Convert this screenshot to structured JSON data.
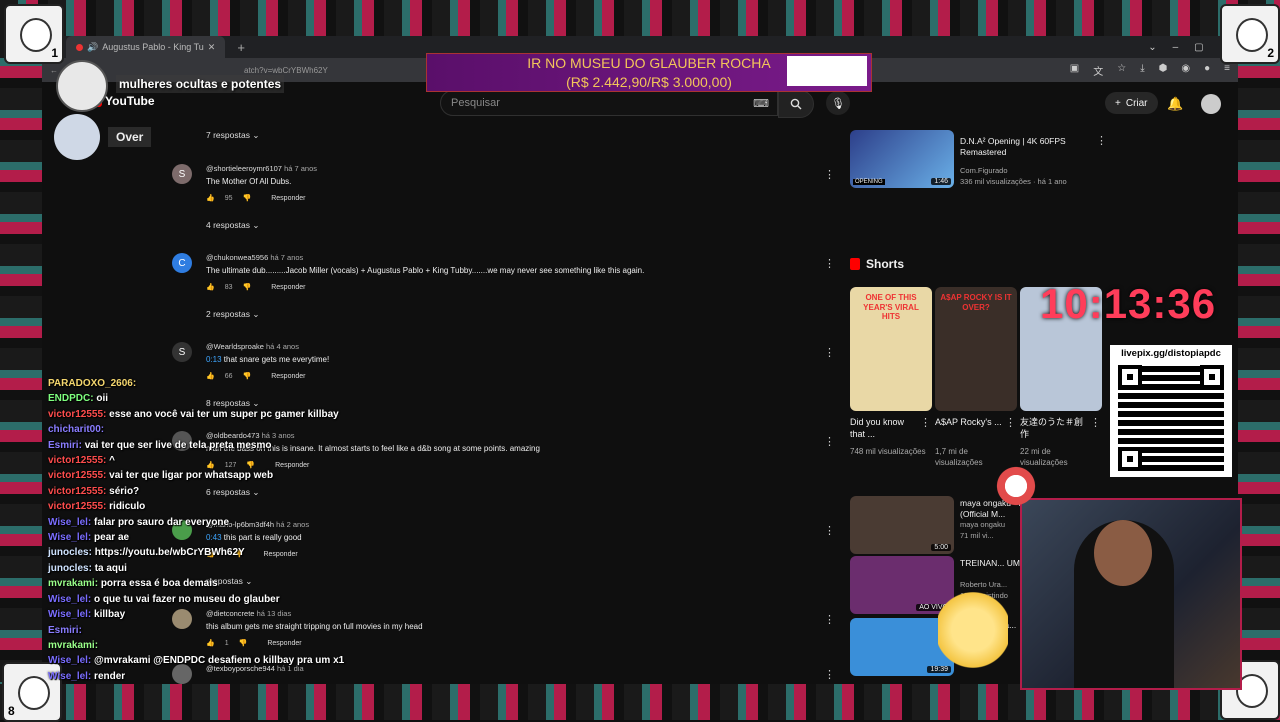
{
  "browser": {
    "tab_title": "Augustus Pablo - King Tu",
    "url": "atch?v=wbCrYBWh62Y"
  },
  "overlay": {
    "title_text": "mulheres ocultas e potentes",
    "over_label": "Over",
    "donation_line1": "IR NO MUSEU DO GLAUBER ROCHA",
    "donation_line2": "(R$ 2.442,90/R$ 3.000,00)",
    "clock": "10:13:36",
    "qr_label": "livepix.gg/distopiapdc",
    "corner_num_left": "1",
    "corner_num_right": "2",
    "corner_num_bl": "8"
  },
  "youtube": {
    "logo": "YouTube",
    "search_placeholder": "Pesquisar",
    "create_label": "Criar"
  },
  "comments": [
    {
      "replies": "7 respostas"
    },
    {
      "initial": "S",
      "user": "@shortieleeroymr6107",
      "age": "há 7 anos",
      "text": "The Mother Of All Dubs.",
      "likes": "95",
      "reply": "Responder",
      "replies": "4 respostas"
    },
    {
      "initial": "C",
      "user": "@chukonwea5956",
      "age": "há 7 anos",
      "text": "The ultimate dub.........Jacob Miller (vocals) + Augustus Pablo + King Tubby.......we may never see something like this again.",
      "likes": "83",
      "reply": "Responder",
      "replies": "2 respostas"
    },
    {
      "initial": "S",
      "user": "@Wearldsproake",
      "age": "há 4 anos",
      "ts": "0:13",
      "text": " that snare gets me everytime!",
      "likes": "66",
      "reply": "Responder",
      "replies": "8 respostas"
    },
    {
      "initial": "",
      "user": "@oldbeardo473",
      "age": "há 3 anos",
      "text": "man the bass on this is insane. It almost starts to feel like a d&b song at some points. amazing",
      "likes": "127",
      "reply": "Responder",
      "replies": "6 respostas"
    },
    {
      "initial": "",
      "user": "@mario-lp6bm3df4h",
      "age": "há 2 anos",
      "ts": "0:43",
      "text": " this part is really good",
      "likes": "",
      "reply": "Responder",
      "replies": "respostas"
    },
    {
      "initial": "",
      "user": "@dietconcrete",
      "age": "há 13 dias",
      "text": "this album gets me straight tripping on full movies in my head",
      "likes": "1",
      "reply": "Responder"
    },
    {
      "initial": "",
      "user": "@texboyporsche944",
      "age": "há 1 dia",
      "text": ""
    }
  ],
  "sidebar": {
    "top_video": {
      "title": "D.N.A² Opening | 4K 60FPS Remastered",
      "channel": "Com.Figurado",
      "meta": "336 mil visualizações · há 1 ano",
      "duration": "1:46",
      "badge": "OPENING"
    },
    "shorts_label": "Shorts",
    "shorts": [
      {
        "title": "Did you know that ...",
        "views": "748 mil visualizações",
        "overlay": "ONE OF THIS YEAR'S VIRAL HITS",
        "color": "#e9d8a6"
      },
      {
        "title": "A$AP Rocky's ...",
        "views": "1,7 mi de visualizações",
        "overlay": "A$AP ROCKY IS IT OVER?",
        "color": "#3a2e28"
      },
      {
        "title": "友達のうた＃創作",
        "views": "22 mi de visualizações",
        "overlay": "",
        "color": "#b9c6d8"
      }
    ],
    "videos": [
      {
        "title": "maya ongaku - Maybe Psychic (Official M...",
        "channel": "maya ongaku",
        "meta": "71 mil vi...",
        "duration": "5:00",
        "color": "#4a3b33"
      },
      {
        "title": "TREINAN... UM JOGAD...",
        "channel": "Roberto Ura...",
        "meta": "158 assistindo",
        "duration": "AO VIVO",
        "color": "#6b2d6e"
      },
      {
        "title": "alyzea - drea...",
        "channel": "ArpWire TV",
        "meta": "",
        "duration": "19:39",
        "color": "#3a8fd9"
      },
      {
        "title": "",
        "channel": "",
        "meta": "",
        "duration": "",
        "color": "#8a2a2a"
      }
    ]
  },
  "chat": [
    {
      "user": "PARADOXO_2606:",
      "msg": "",
      "color": "#f5d76e"
    },
    {
      "user": "ENDPDC:",
      "msg": "oii",
      "color": "#7fff7f"
    },
    {
      "user": "victor12555:",
      "msg": "esse ano você vai ter um super pc gamer killbay",
      "color": "#ff4d4d"
    },
    {
      "user": "chicharit00:",
      "msg": "",
      "color": "#8a7dff"
    },
    {
      "user": "Esmiri:",
      "msg": "vai ter que ser live de tela preta mesmo",
      "color": "#8a7dff"
    },
    {
      "user": "victor12555:",
      "msg": "^",
      "color": "#ff4d4d"
    },
    {
      "user": "victor12555:",
      "msg": "vai ter que ligar por whatsapp web",
      "color": "#ff4d4d"
    },
    {
      "user": "victor12555:",
      "msg": "sério?",
      "color": "#ff4d4d"
    },
    {
      "user": "victor12555:",
      "msg": "ridiculo",
      "color": "#ff4d4d"
    },
    {
      "user": "Wise_lel:",
      "msg": "falar pro sauro dar everyone",
      "color": "#7a6dff"
    },
    {
      "user": "Wise_lel:",
      "msg": "pear ae",
      "color": "#7a6dff"
    },
    {
      "user": "junocles:",
      "msg": "https://youtu.be/wbCrYBWh62Y",
      "color": "#cfe3ff"
    },
    {
      "user": "junocles:",
      "msg": "ta aqui",
      "color": "#cfe3ff"
    },
    {
      "user": "mvrakami:",
      "msg": "porra essa é boa demais",
      "color": "#9aff8a"
    },
    {
      "user": "Wise_lel:",
      "msg": "o que tu vai fazer no museu do glauber",
      "color": "#7a6dff"
    },
    {
      "user": "Wise_lel:",
      "msg": "killbay",
      "color": "#7a6dff"
    },
    {
      "user": "Esmiri:",
      "msg": "",
      "color": "#8a7dff"
    },
    {
      "user": "mvrakami:",
      "msg": "",
      "color": "#9aff8a"
    },
    {
      "user": "Wise_lel:",
      "msg": "@mvrakami @ENDPDC desafiem o killbay pra um x1",
      "color": "#7a6dff"
    },
    {
      "user": "Wise_lel:",
      "msg": "render",
      "color": "#7a6dff"
    }
  ]
}
